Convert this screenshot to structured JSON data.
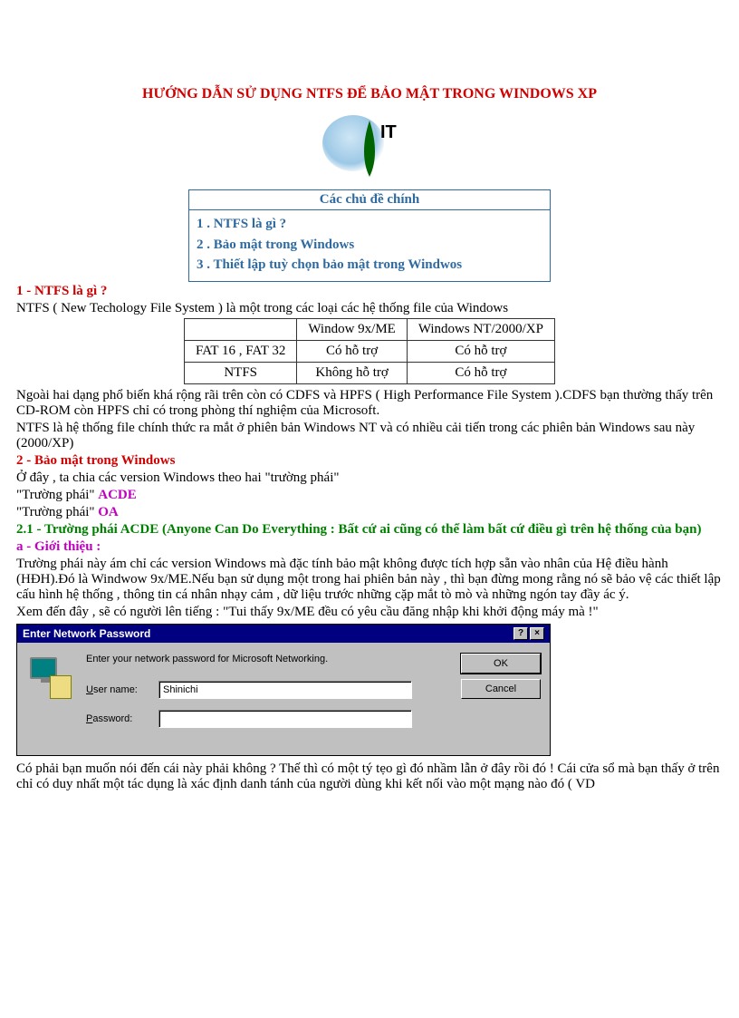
{
  "title": "HƯỚNG DẪN SỬ DỤNG NTFS ĐỂ BẢO MẬT TRONG WINDOWS XP",
  "logo_text": "IT",
  "toc": {
    "header": "Các chủ đề chính",
    "items": [
      "1 . NTFS là gì ?",
      "2 . Bảo mật trong Windows",
      "3 . Thiết lập tuỳ chọn bảo mật trong Windwos"
    ]
  },
  "section1": {
    "heading": "1 - NTFS là gì ?",
    "intro": "NTFS  ( New Techology  File System  ) là một trong các loại các hệ thống file  của Windows",
    "table": {
      "col1": "Window 9x/ME",
      "col2": "Windows NT/2000/XP",
      "row1_label": "FAT 16 , FAT 32",
      "row1_c1": "Có hỗ trợ",
      "row1_c2": "Có hỗ trợ",
      "row2_label": "NTFS",
      "row2_c1": "Không hỗ trợ",
      "row2_c2": "Có hỗ trợ"
    },
    "p1": "Ngoài hai dạng phổ biến khá rộng rãi trên còn có CDFS và HPFS ( High Performance  File System  ).CDFS bạn thường thấy trên CD-ROM còn HPFS chỉ có trong phòng thí nghiệm  của Microsoft.",
    "p2": "NTFS là hệ thống file  chính thức ra mắt ở phiên bản Windows NT và có nhiều  cải tiến trong các phiên bản Windows sau này (2000/XP)"
  },
  "section2": {
    "heading": "2 - Bảo mật trong Windows",
    "p1": "Ở đây , ta chia các version  Windows  theo hai \"trường  phái\"",
    "line_a_prefix": "\"Trường phái\"  ",
    "line_a_label": "ACDE",
    "line_b_prefix": "\"Trường  phái\"  ",
    "line_b_label": "OA",
    "sub_heading": "2.1 - Trường phái ACDE (Anyone Can Do Everything : Bất cứ ai cũng có thể làm bất cứ điều gì trên hệ thống của bạn)",
    "a_intro": "a - Giới thiệu :",
    "p2": "Trường phái này ám chỉ các version  Windows  mà đặc tính  bảo mật không  được tích hợp sẵn vào nhân của Hệ điều hành (HĐH).Đó là Windwow 9x/ME.Nếu bạn sử dụng một trong hai phiên bản này , thì bạn đừng mong rằng nó sẽ bảo vệ các thiết  lập cấu hình hệ thống , thông tin cá nhân nhạy cảm , dữ liệu trước những  cặp mắt tò mò và những  ngón tay đầy ác ý.",
    "p3": "Xem đến đây , sẽ có người lên tiếng  : \"Tui thấy 9x/ME đều có yêu cầu đăng nhập khi khởi động máy mà !\""
  },
  "dialog": {
    "title": "Enter Network Password",
    "help_symbol": "?",
    "close_symbol": "×",
    "message": "Enter your network password for Microsoft Networking.",
    "user_label": "User name:",
    "user_value": "Shinichi",
    "pass_label": "Password:",
    "pass_value": "",
    "ok": "OK",
    "cancel": "Cancel"
  },
  "closing_p": "Có phải bạn muốn nói đến cái này phải không ? Thế thì có một tý tẹo gì đó nhầm lẫn ở đây rồi đó ! Cái cửa sổ mà bạn thấy ở trên chỉ có duy nhất một tác dụng là xác định  danh tánh của người dùng khi kết nối vào một mạng nào đó ( VD"
}
